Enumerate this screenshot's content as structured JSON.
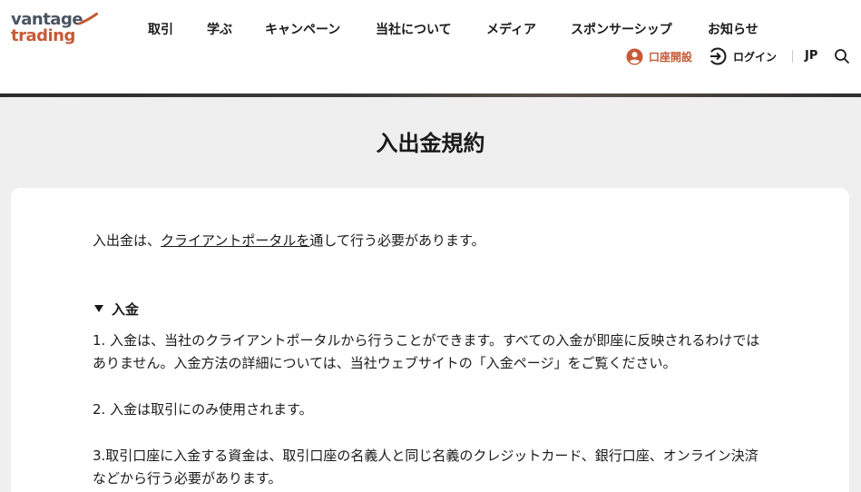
{
  "header": {
    "logo": {
      "top": "vantage",
      "bottom": "trading"
    },
    "nav": [
      {
        "label": "取引"
      },
      {
        "label": "学ぶ"
      },
      {
        "label": "キャンペーン"
      },
      {
        "label": "当社について"
      },
      {
        "label": "メディア"
      },
      {
        "label": "スポンサーシップ"
      },
      {
        "label": "お知らせ"
      }
    ],
    "open_account_label": "口座開設",
    "login_label": "ログイン",
    "language": "JP"
  },
  "page": {
    "title": "入出金規約",
    "intro_before": "入出金は、",
    "intro_link": "クライアントポータルを",
    "intro_after": "通して行う必要があります。",
    "section": {
      "label": "入金",
      "paragraphs": [
        "1. 入金は、当社のクライアントポータルから行うことができます。すべての入金が即座に反映されるわけではありません。入金方法の詳細については、当社ウェブサイトの「入金ページ」をご覧ください。",
        "2. 入金は取引にのみ使用されます。",
        "3.取引口座に入金する資金は、取引口座の名義人と同じ名義のクレジットカード、銀行口座、オンライン決済などから行う必要があります。"
      ]
    }
  },
  "colors": {
    "accent": "#c65a36",
    "logo_gray": "#4a5560",
    "background": "#efefef",
    "card": "#ffffff"
  },
  "icons": {
    "open_account": "user-circle-icon",
    "login": "login-arrow-icon",
    "search": "search-icon",
    "section_toggle": "triangle-down-icon"
  }
}
